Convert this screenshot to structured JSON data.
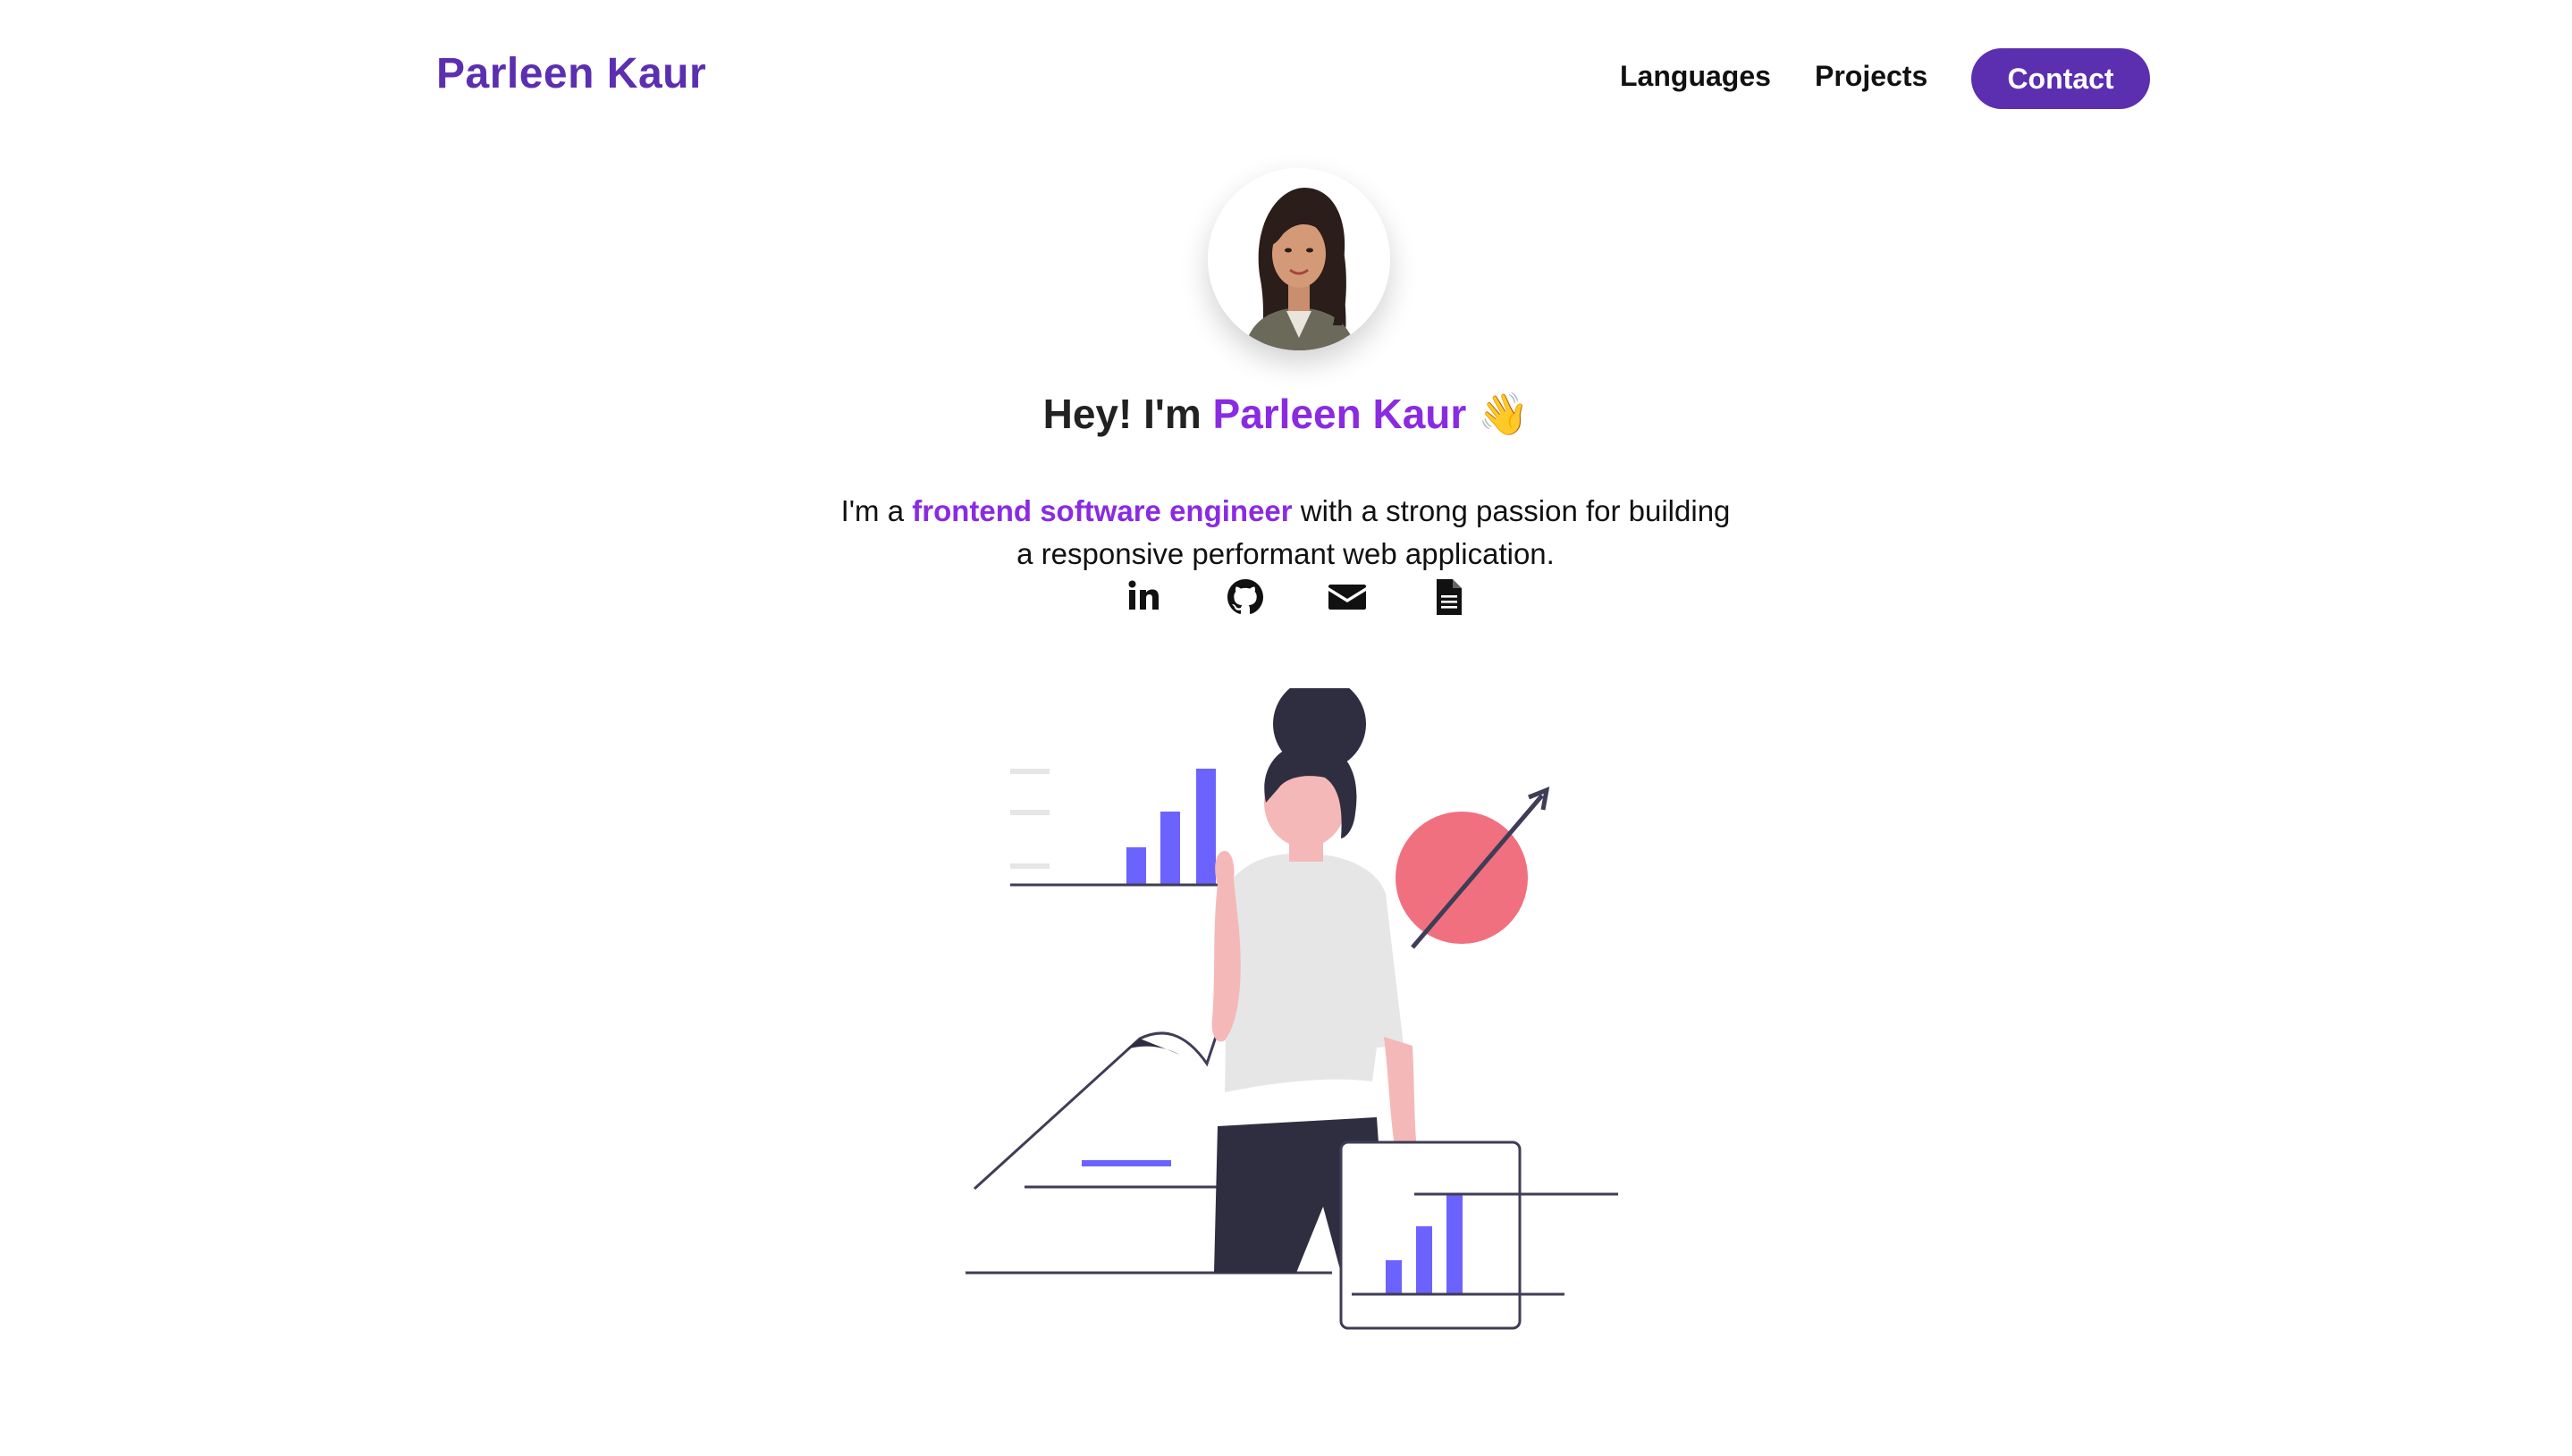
{
  "header": {
    "brand": "Parleen Kaur",
    "nav": {
      "languages": "Languages",
      "projects": "Projects",
      "contact": "Contact"
    }
  },
  "hero": {
    "greeting": "Hey! I'm ",
    "name": "Parleen Kaur",
    "wave_emoji": "👋",
    "bio_prefix": "I'm a ",
    "bio_highlight": "frontend software engineer",
    "bio_suffix": " with a strong passion for building a responsive performant web application."
  },
  "social_icons": [
    "linkedin-icon",
    "github-icon",
    "email-icon",
    "resume-icon"
  ],
  "colors": {
    "brand_purple": "#5b2fb0",
    "accent_purple": "#8a2be2",
    "illustration_bars": "#6c63ff",
    "illustration_circle": "#f07080",
    "illustration_dark": "#2f2e41",
    "skin": "#f5b8b8"
  }
}
